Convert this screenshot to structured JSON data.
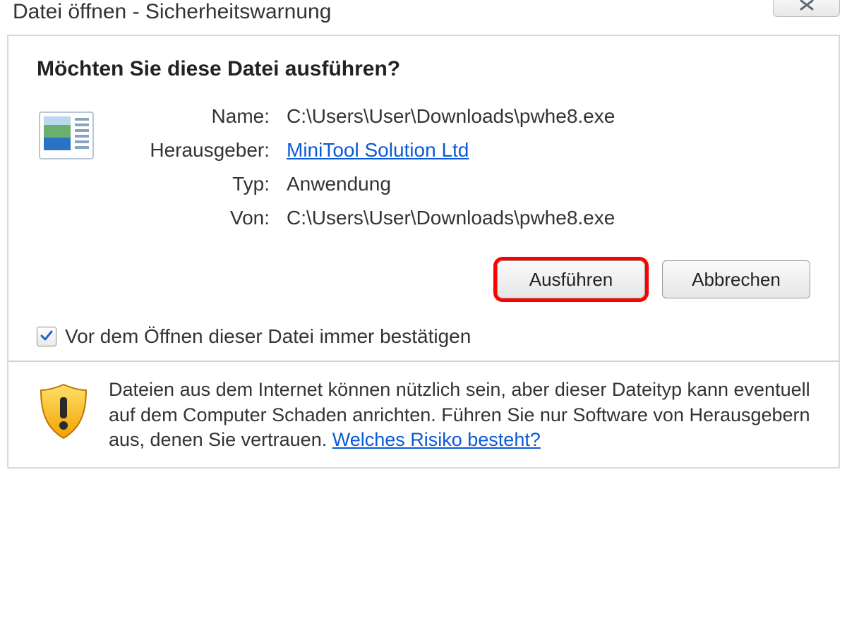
{
  "titlebar": {
    "title": "Datei öffnen - Sicherheitswarnung"
  },
  "dialog": {
    "heading": "Möchten Sie diese Datei ausführen?",
    "labels": {
      "name": "Name:",
      "publisher": "Herausgeber:",
      "type": "Typ:",
      "from": "Von:"
    },
    "values": {
      "name": "C:\\Users\\User\\Downloads\\pwhe8.exe",
      "publisher": "MiniTool Solution Ltd",
      "type": "Anwendung",
      "from": "C:\\Users\\User\\Downloads\\pwhe8.exe"
    },
    "buttons": {
      "run": "Ausführen",
      "cancel": "Abbrechen"
    },
    "checkbox_label": "Vor dem Öffnen dieser Datei immer bestätigen",
    "checkbox_checked": true,
    "warning_text_1": "Dateien aus dem Internet können nützlich sein, aber dieser Dateityp kann eventuell auf dem Computer Schaden anrichten. Führen Sie nur Software von Herausgebern aus, denen Sie vertrauen. ",
    "risk_link": "Welches Risiko besteht?"
  }
}
